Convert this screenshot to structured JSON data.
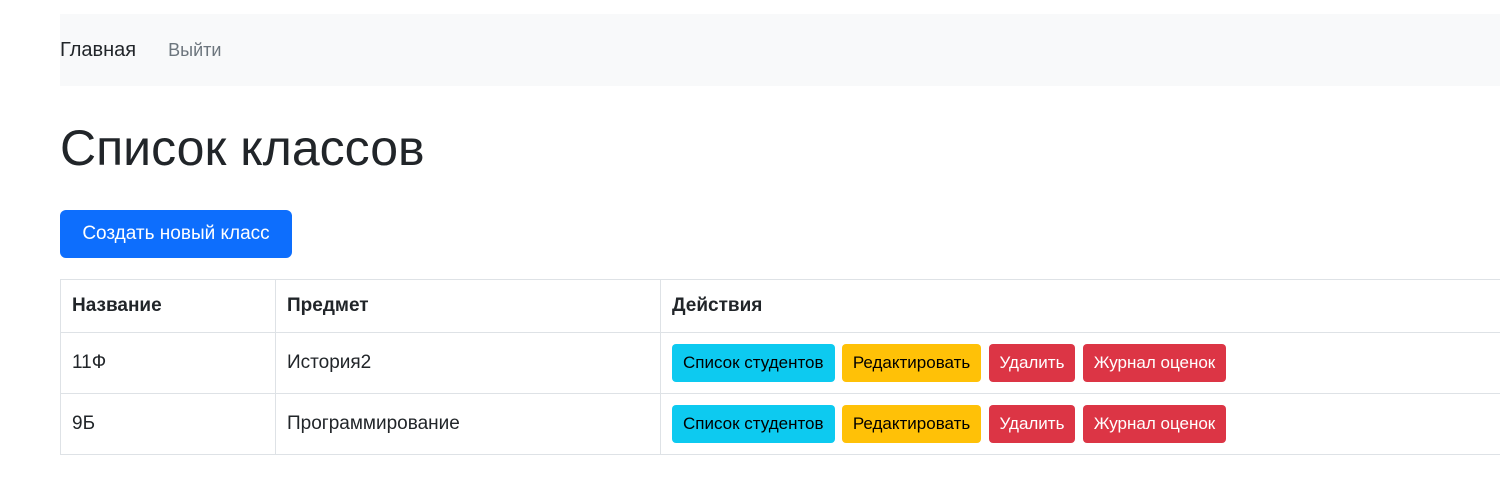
{
  "navbar": {
    "brand": "Главная",
    "logout": "Выйти"
  },
  "page": {
    "title": "Список классов",
    "create_button": "Создать новый класс"
  },
  "table": {
    "headers": [
      "Название",
      "Предмет",
      "Действия"
    ],
    "rows": [
      {
        "name": "11Ф",
        "subject": "История2",
        "actions": [
          "Список студентов",
          "Редактировать",
          "Удалить",
          "Журнал оценок"
        ]
      },
      {
        "name": "9Б",
        "subject": "Программирование",
        "actions": [
          "Список студентов",
          "Редактировать",
          "Удалить",
          "Журнал оценок"
        ]
      }
    ]
  },
  "colors": {
    "primary": "#0d6efd",
    "info": "#0dcaf0",
    "warning": "#ffc107",
    "danger": "#dc3545",
    "navbar_bg": "#f8f9fa"
  }
}
